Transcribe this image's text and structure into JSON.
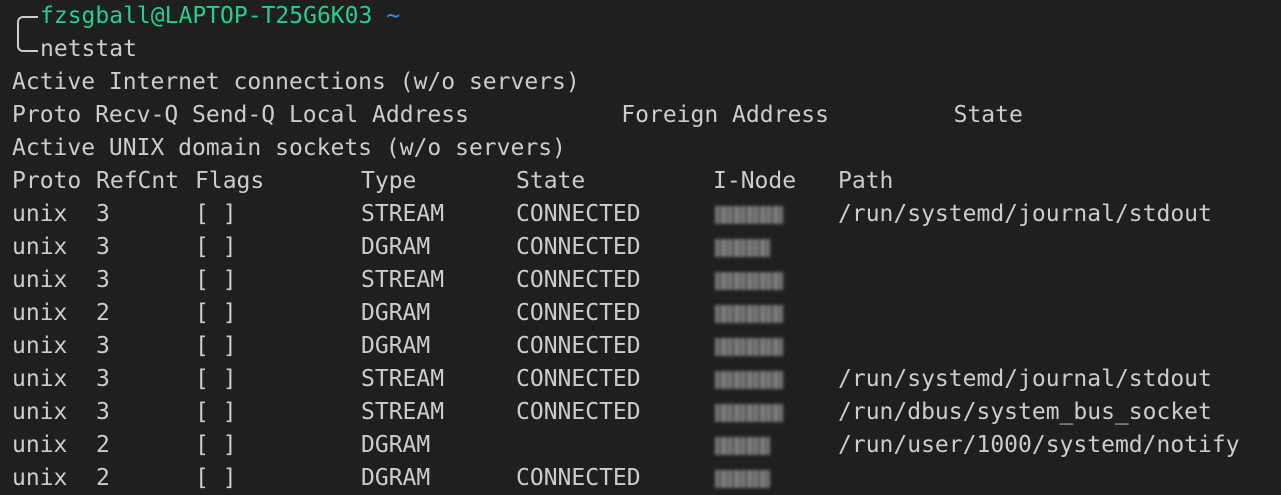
{
  "prompt": {
    "user_host": "fzsgball@LAPTOP-T25G6K03",
    "cwd": "~",
    "command": "netstat"
  },
  "output": {
    "inet_header": "Active Internet connections (w/o servers)",
    "inet_columns": "Proto Recv-Q Send-Q Local Address           Foreign Address         State",
    "unix_header": "Active UNIX domain sockets (w/o servers)",
    "unix_columns": {
      "proto": "Proto",
      "refcnt": "RefCnt",
      "flags": "Flags",
      "type": "Type",
      "state": "State",
      "inode": "I-Node",
      "path": "Path"
    },
    "rows": [
      {
        "proto": "unix",
        "refcnt": "3",
        "flags": "[ ]",
        "type": "STREAM",
        "state": "CONNECTED",
        "path": "/run/systemd/journal/stdout"
      },
      {
        "proto": "unix",
        "refcnt": "3",
        "flags": "[ ]",
        "type": "DGRAM",
        "state": "CONNECTED",
        "path": ""
      },
      {
        "proto": "unix",
        "refcnt": "3",
        "flags": "[ ]",
        "type": "STREAM",
        "state": "CONNECTED",
        "path": ""
      },
      {
        "proto": "unix",
        "refcnt": "2",
        "flags": "[ ]",
        "type": "DGRAM",
        "state": "CONNECTED",
        "path": ""
      },
      {
        "proto": "unix",
        "refcnt": "3",
        "flags": "[ ]",
        "type": "DGRAM",
        "state": "CONNECTED",
        "path": ""
      },
      {
        "proto": "unix",
        "refcnt": "3",
        "flags": "[ ]",
        "type": "STREAM",
        "state": "CONNECTED",
        "path": "/run/systemd/journal/stdout"
      },
      {
        "proto": "unix",
        "refcnt": "3",
        "flags": "[ ]",
        "type": "STREAM",
        "state": "CONNECTED",
        "path": "/run/dbus/system_bus_socket"
      },
      {
        "proto": "unix",
        "refcnt": "2",
        "flags": "[ ]",
        "type": "DGRAM",
        "state": "",
        "path": "/run/user/1000/systemd/notify"
      },
      {
        "proto": "unix",
        "refcnt": "2",
        "flags": "[ ]",
        "type": "DGRAM",
        "state": "CONNECTED",
        "path": ""
      }
    ]
  },
  "colors": {
    "background": "#1f1f1f",
    "text": "#cccccc",
    "prompt_user": "#23d18b",
    "prompt_cwd": "#3b8eea"
  }
}
